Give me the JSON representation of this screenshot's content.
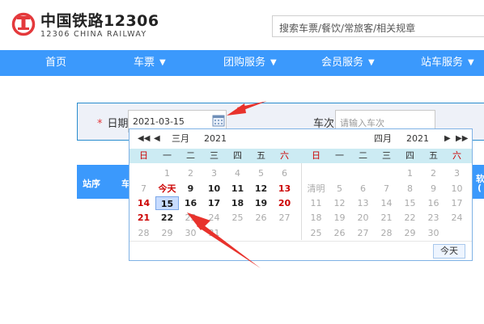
{
  "header": {
    "brand_title": "中国铁路12306",
    "brand_subtitle": "12306 CHINA RAILWAY",
    "search_placeholder": "搜索车票/餐饮/常旅客/相关规章"
  },
  "nav": {
    "items": [
      {
        "label": "首页",
        "has_chevron": false
      },
      {
        "label": "车票",
        "has_chevron": true
      },
      {
        "label": "团购服务",
        "has_chevron": true
      },
      {
        "label": "会员服务",
        "has_chevron": true
      },
      {
        "label": "站车服务",
        "has_chevron": true
      }
    ]
  },
  "query": {
    "required_mark": "*",
    "date_label": "日期",
    "date_value": "2021-03-15",
    "train_label": "车次",
    "train_placeholder": "请输入车次"
  },
  "result_bar": {
    "col1": "站序",
    "col2": "车",
    "col_right": "软",
    "col_right2": "("
  },
  "calendar": {
    "left": {
      "month": "三月",
      "year": "2021",
      "prev_year": "◀◀",
      "prev_month": "◀"
    },
    "right": {
      "month": "四月",
      "year": "2021",
      "next_month": "▶",
      "next_year": "▶▶"
    },
    "weekdays": [
      "日",
      "一",
      "二",
      "三",
      "四",
      "五",
      "六"
    ],
    "march_rows": [
      [
        "",
        "1",
        "2",
        "3",
        "4",
        "5",
        "6"
      ],
      [
        "7",
        "今天",
        "9",
        "10",
        "11",
        "12",
        "13"
      ],
      [
        "14",
        "15",
        "16",
        "17",
        "18",
        "19",
        "20"
      ],
      [
        "21",
        "22",
        "23",
        "24",
        "25",
        "26",
        "27"
      ],
      [
        "28",
        "29",
        "30",
        "31",
        "",
        "",
        ""
      ]
    ],
    "april_rows": [
      [
        "",
        "",
        "",
        "",
        "1",
        "2",
        "3"
      ],
      [
        "清明",
        "5",
        "6",
        "7",
        "8",
        "9",
        "10"
      ],
      [
        "11",
        "12",
        "13",
        "14",
        "15",
        "16",
        "17"
      ],
      [
        "18",
        "19",
        "20",
        "21",
        "22",
        "23",
        "24"
      ],
      [
        "25",
        "26",
        "27",
        "28",
        "29",
        "30",
        ""
      ]
    ],
    "selected_day": "15",
    "today_label": "今天",
    "today_button": "今天"
  },
  "colors": {
    "nav_blue": "#3b99fc",
    "logo_red": "#e4393c",
    "weekend_red": "#cc0000",
    "arrow_red": "#e8322c"
  }
}
